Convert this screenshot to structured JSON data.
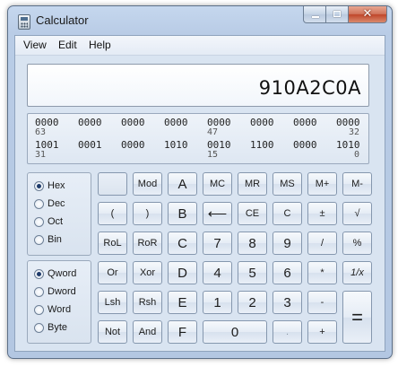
{
  "window": {
    "title": "Calculator"
  },
  "caption": {
    "minimize": "minimize-icon",
    "maximize": "maximize-icon",
    "close": "close-icon"
  },
  "menu": [
    "View",
    "Edit",
    "Help"
  ],
  "display": {
    "value": "910A2C0A"
  },
  "bits": {
    "row1": [
      "0000",
      "0000",
      "0000",
      "0000",
      "0000",
      "0000",
      "0000",
      "0000"
    ],
    "row1_positions": [
      "63",
      "47",
      "32"
    ],
    "row2": [
      "1001",
      "0001",
      "0000",
      "1010",
      "0010",
      "1100",
      "0000",
      "1010"
    ],
    "row2_positions": [
      "31",
      "15",
      "0"
    ]
  },
  "base_modes": [
    "Hex",
    "Dec",
    "Oct",
    "Bin"
  ],
  "base_selected": "Hex",
  "word_sizes": [
    "Qword",
    "Dword",
    "Word",
    "Byte"
  ],
  "word_selected": "Qword",
  "keys": {
    "mod": "Mod",
    "a": "A",
    "mc": "MC",
    "mr": "MR",
    "ms": "MS",
    "mplus": "M+",
    "mminus": "M-",
    "lparen": "(",
    "rparen": ")",
    "b": "B",
    "backspace": "⟵",
    "ce": "CE",
    "c": "C",
    "plusminus": "±",
    "sqrt": "√",
    "rol": "RoL",
    "ror": "RoR",
    "cc": "C",
    "seven": "7",
    "eight": "8",
    "nine": "9",
    "divide": "/",
    "percent": "%",
    "or": "Or",
    "xor": "Xor",
    "d": "D",
    "four": "4",
    "five": "5",
    "six": "6",
    "multiply": "*",
    "reciprocal": "1/x",
    "lsh": "Lsh",
    "rsh": "Rsh",
    "e": "E",
    "one": "1",
    "two": "2",
    "three": "3",
    "minus": "-",
    "equals": "=",
    "not": "Not",
    "and": "And",
    "f": "F",
    "zero": "0",
    "decimal": ".",
    "plus": "+"
  }
}
